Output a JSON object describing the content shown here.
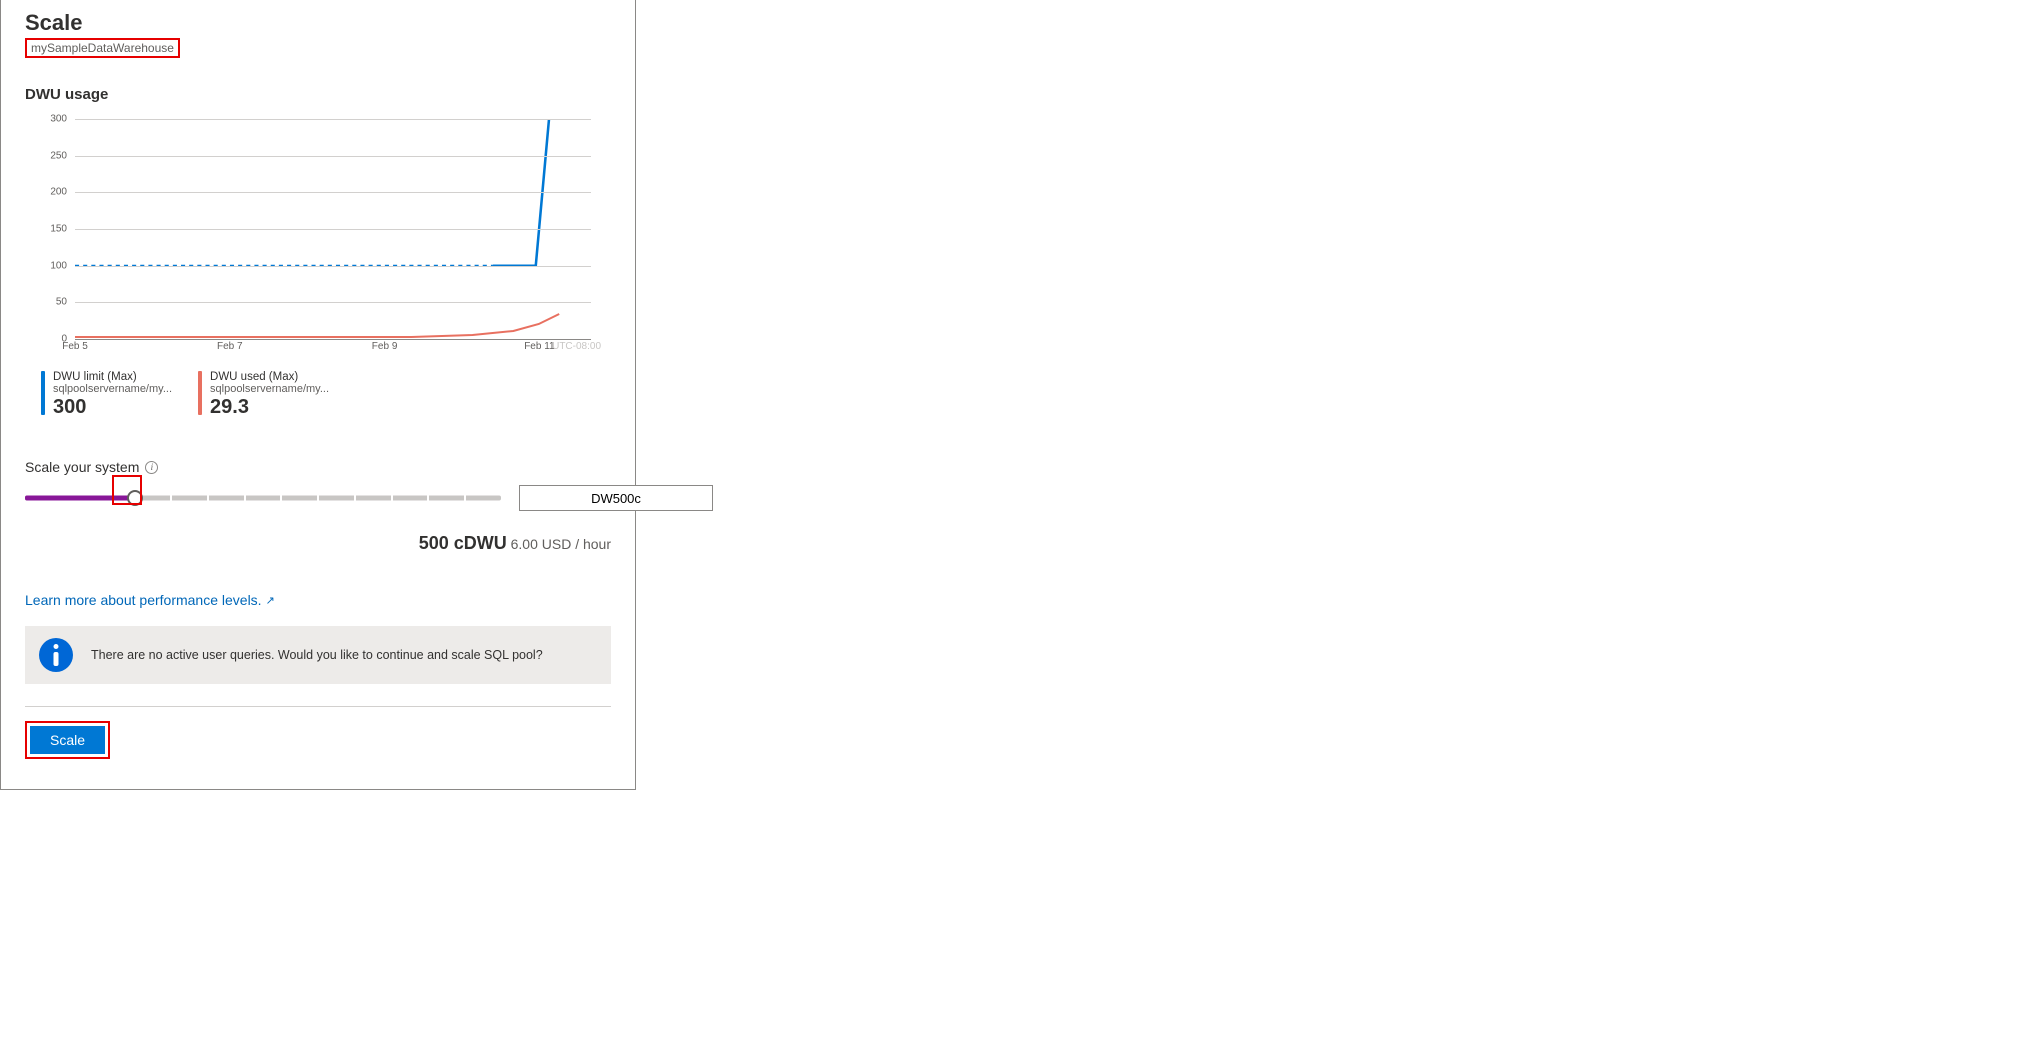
{
  "header": {
    "title": "Scale",
    "subtitle": "mySampleDataWarehouse"
  },
  "usage": {
    "section_title": "DWU usage",
    "y_ticks": [
      "300",
      "250",
      "200",
      "150",
      "100",
      "50",
      "0"
    ],
    "x_ticks": [
      "Feb 5",
      "Feb 7",
      "Feb 9",
      "Feb 11"
    ],
    "timezone": "UTC-08:00",
    "legend": [
      {
        "title": "DWU limit (Max)",
        "sub": "sqlpoolservername/my...",
        "value": "300"
      },
      {
        "title": "DWU used (Max)",
        "sub": "sqlpoolservername/my...",
        "value": "29.3"
      }
    ]
  },
  "scale": {
    "label": "Scale your system",
    "value_display": "DW500c",
    "segments": 13,
    "filled_segments": 3,
    "cdwu": "500 cDWU",
    "price": "6.00 USD / hour"
  },
  "learn_more": "Learn more about performance levels.",
  "info_message": "There are no active user queries. Would you like to continue and scale SQL pool?",
  "action_button": "Scale",
  "chart_data": {
    "type": "line",
    "xlabel": "",
    "ylabel": "",
    "ylim": [
      0,
      300
    ],
    "x": [
      "Feb 5",
      "Feb 6",
      "Feb 7",
      "Feb 8",
      "Feb 9",
      "Feb 10",
      "Feb 11",
      "Feb 11.5"
    ],
    "series": [
      {
        "name": "DWU limit (Max)",
        "color": "#0078d4",
        "style": "dashed-then-solid",
        "values": [
          100,
          100,
          100,
          100,
          100,
          100,
          100,
          300
        ]
      },
      {
        "name": "DWU used (Max)",
        "color": "#e87060",
        "values": [
          3,
          3,
          3,
          3,
          3,
          4,
          10,
          29.3
        ]
      }
    ],
    "y_ticks": [
      0,
      50,
      100,
      150,
      200,
      250,
      300
    ],
    "x_ticks": [
      "Feb 5",
      "Feb 7",
      "Feb 9",
      "Feb 11"
    ]
  }
}
